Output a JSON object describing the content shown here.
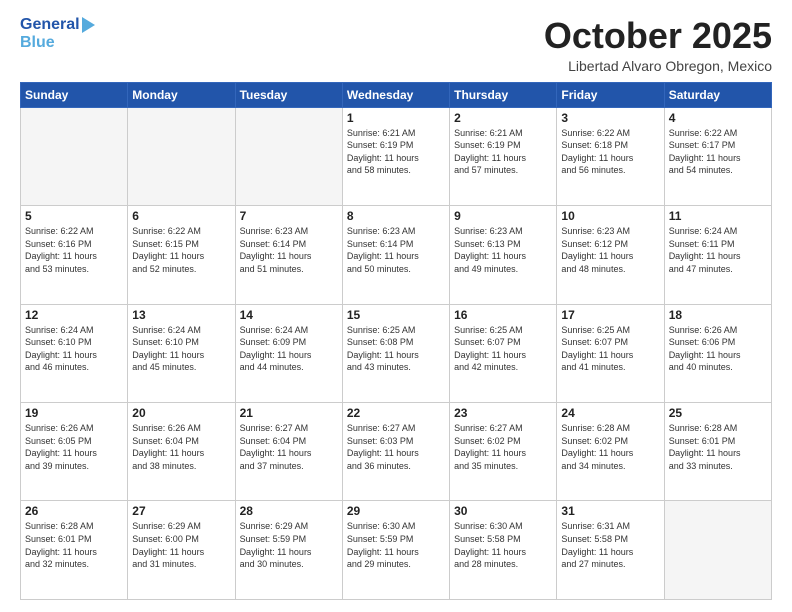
{
  "header": {
    "logo_line1": "General",
    "logo_line2": "Blue",
    "month_title": "October 2025",
    "location": "Libertad Alvaro Obregon, Mexico"
  },
  "weekdays": [
    "Sunday",
    "Monday",
    "Tuesday",
    "Wednesday",
    "Thursday",
    "Friday",
    "Saturday"
  ],
  "weeks": [
    [
      {
        "day": "",
        "info": ""
      },
      {
        "day": "",
        "info": ""
      },
      {
        "day": "",
        "info": ""
      },
      {
        "day": "1",
        "info": "Sunrise: 6:21 AM\nSunset: 6:19 PM\nDaylight: 11 hours\nand 58 minutes."
      },
      {
        "day": "2",
        "info": "Sunrise: 6:21 AM\nSunset: 6:19 PM\nDaylight: 11 hours\nand 57 minutes."
      },
      {
        "day": "3",
        "info": "Sunrise: 6:22 AM\nSunset: 6:18 PM\nDaylight: 11 hours\nand 56 minutes."
      },
      {
        "day": "4",
        "info": "Sunrise: 6:22 AM\nSunset: 6:17 PM\nDaylight: 11 hours\nand 54 minutes."
      }
    ],
    [
      {
        "day": "5",
        "info": "Sunrise: 6:22 AM\nSunset: 6:16 PM\nDaylight: 11 hours\nand 53 minutes."
      },
      {
        "day": "6",
        "info": "Sunrise: 6:22 AM\nSunset: 6:15 PM\nDaylight: 11 hours\nand 52 minutes."
      },
      {
        "day": "7",
        "info": "Sunrise: 6:23 AM\nSunset: 6:14 PM\nDaylight: 11 hours\nand 51 minutes."
      },
      {
        "day": "8",
        "info": "Sunrise: 6:23 AM\nSunset: 6:14 PM\nDaylight: 11 hours\nand 50 minutes."
      },
      {
        "day": "9",
        "info": "Sunrise: 6:23 AM\nSunset: 6:13 PM\nDaylight: 11 hours\nand 49 minutes."
      },
      {
        "day": "10",
        "info": "Sunrise: 6:23 AM\nSunset: 6:12 PM\nDaylight: 11 hours\nand 48 minutes."
      },
      {
        "day": "11",
        "info": "Sunrise: 6:24 AM\nSunset: 6:11 PM\nDaylight: 11 hours\nand 47 minutes."
      }
    ],
    [
      {
        "day": "12",
        "info": "Sunrise: 6:24 AM\nSunset: 6:10 PM\nDaylight: 11 hours\nand 46 minutes."
      },
      {
        "day": "13",
        "info": "Sunrise: 6:24 AM\nSunset: 6:10 PM\nDaylight: 11 hours\nand 45 minutes."
      },
      {
        "day": "14",
        "info": "Sunrise: 6:24 AM\nSunset: 6:09 PM\nDaylight: 11 hours\nand 44 minutes."
      },
      {
        "day": "15",
        "info": "Sunrise: 6:25 AM\nSunset: 6:08 PM\nDaylight: 11 hours\nand 43 minutes."
      },
      {
        "day": "16",
        "info": "Sunrise: 6:25 AM\nSunset: 6:07 PM\nDaylight: 11 hours\nand 42 minutes."
      },
      {
        "day": "17",
        "info": "Sunrise: 6:25 AM\nSunset: 6:07 PM\nDaylight: 11 hours\nand 41 minutes."
      },
      {
        "day": "18",
        "info": "Sunrise: 6:26 AM\nSunset: 6:06 PM\nDaylight: 11 hours\nand 40 minutes."
      }
    ],
    [
      {
        "day": "19",
        "info": "Sunrise: 6:26 AM\nSunset: 6:05 PM\nDaylight: 11 hours\nand 39 minutes."
      },
      {
        "day": "20",
        "info": "Sunrise: 6:26 AM\nSunset: 6:04 PM\nDaylight: 11 hours\nand 38 minutes."
      },
      {
        "day": "21",
        "info": "Sunrise: 6:27 AM\nSunset: 6:04 PM\nDaylight: 11 hours\nand 37 minutes."
      },
      {
        "day": "22",
        "info": "Sunrise: 6:27 AM\nSunset: 6:03 PM\nDaylight: 11 hours\nand 36 minutes."
      },
      {
        "day": "23",
        "info": "Sunrise: 6:27 AM\nSunset: 6:02 PM\nDaylight: 11 hours\nand 35 minutes."
      },
      {
        "day": "24",
        "info": "Sunrise: 6:28 AM\nSunset: 6:02 PM\nDaylight: 11 hours\nand 34 minutes."
      },
      {
        "day": "25",
        "info": "Sunrise: 6:28 AM\nSunset: 6:01 PM\nDaylight: 11 hours\nand 33 minutes."
      }
    ],
    [
      {
        "day": "26",
        "info": "Sunrise: 6:28 AM\nSunset: 6:01 PM\nDaylight: 11 hours\nand 32 minutes."
      },
      {
        "day": "27",
        "info": "Sunrise: 6:29 AM\nSunset: 6:00 PM\nDaylight: 11 hours\nand 31 minutes."
      },
      {
        "day": "28",
        "info": "Sunrise: 6:29 AM\nSunset: 5:59 PM\nDaylight: 11 hours\nand 30 minutes."
      },
      {
        "day": "29",
        "info": "Sunrise: 6:30 AM\nSunset: 5:59 PM\nDaylight: 11 hours\nand 29 minutes."
      },
      {
        "day": "30",
        "info": "Sunrise: 6:30 AM\nSunset: 5:58 PM\nDaylight: 11 hours\nand 28 minutes."
      },
      {
        "day": "31",
        "info": "Sunrise: 6:31 AM\nSunset: 5:58 PM\nDaylight: 11 hours\nand 27 minutes."
      },
      {
        "day": "",
        "info": ""
      }
    ]
  ]
}
